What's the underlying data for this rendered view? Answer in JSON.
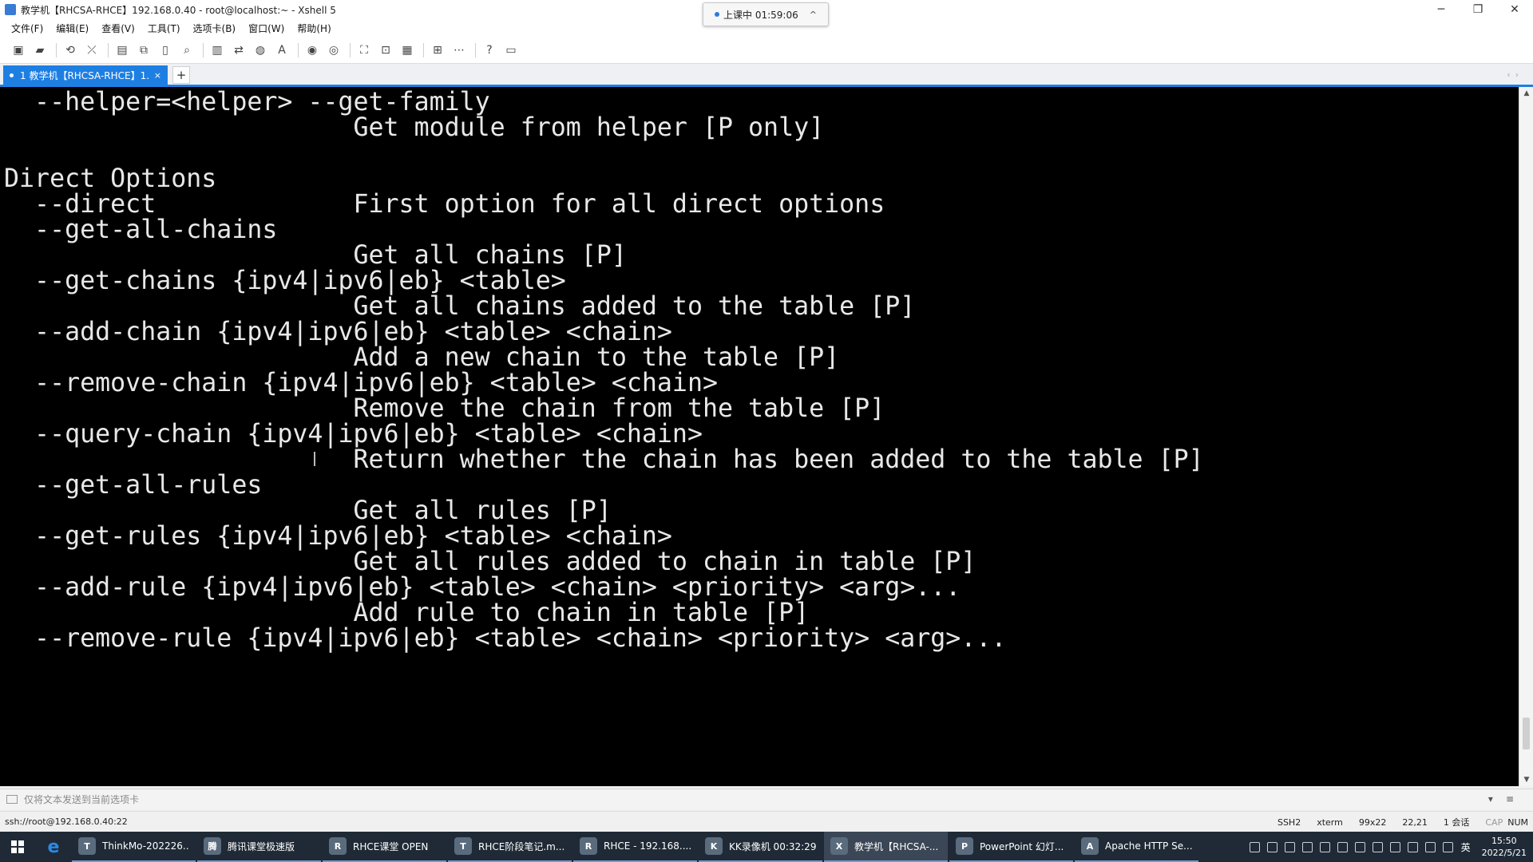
{
  "window": {
    "title": "教学机【RHCSA-RHCE】192.168.0.40 - root@localhost:~ - Xshell 5",
    "minimize": "─",
    "restore": "❐",
    "close": "✕"
  },
  "class_indicator": {
    "text": "上课中 01:59:06",
    "chevron": "^"
  },
  "menu": [
    "文件(F)",
    "编辑(E)",
    "查看(V)",
    "工具(T)",
    "选项卡(B)",
    "窗口(W)",
    "帮助(H)"
  ],
  "toolbar_icons": [
    "new-session-icon",
    "open-folder-icon",
    "reconnect-icon",
    "disconnect-icon",
    "properties-icon",
    "copy-icon",
    "paste-icon",
    "find-icon",
    "print-icon",
    "transfer-icon",
    "globe-icon",
    "font-icon",
    "xftp-icon",
    "xmanager-icon",
    "fullscreen-icon",
    "lock-icon",
    "keyboard-icon",
    "new-tab-icon",
    "layout-icon",
    "help-icon",
    "chat-icon"
  ],
  "tab": {
    "label": "1 教学机【RHCSA-RHCE】1...",
    "close": "×",
    "add": "+"
  },
  "terminal": {
    "lines": [
      "  --helper=<helper> --get-family",
      "                       Get module from helper [P only]",
      "",
      "Direct Options",
      "  --direct             First option for all direct options",
      "  --get-all-chains",
      "                       Get all chains [P]",
      "  --get-chains {ipv4|ipv6|eb} <table>",
      "                       Get all chains added to the table [P]",
      "  --add-chain {ipv4|ipv6|eb} <table> <chain>",
      "                       Add a new chain to the table [P]",
      "  --remove-chain {ipv4|ipv6|eb} <table> <chain>",
      "                       Remove the chain from the table [P]",
      "  --query-chain {ipv4|ipv6|eb} <table> <chain>",
      "                       Return whether the chain has been added to the table [P]",
      "  --get-all-rules",
      "                       Get all rules [P]",
      "  --get-rules {ipv4|ipv6|eb} <table> <chain>",
      "                       Get all rules added to chain in table [P]",
      "  --add-rule {ipv4|ipv6|eb} <table> <chain> <priority> <arg>...",
      "                       Add rule to chain in table [P]",
      "  --remove-rule {ipv4|ipv6|eb} <table> <chain> <priority> <arg>..."
    ]
  },
  "compose_bar": {
    "placeholder": "仅将文本发送到当前选项卡"
  },
  "statusbar": {
    "connection": "ssh://root@192.168.0.40:22",
    "protocol": "SSH2",
    "terminal_type": "xterm",
    "size": "99x22",
    "cursor_pos": "22,21",
    "sessions": "1 会话",
    "caps": "CAP",
    "num": "NUM"
  },
  "taskbar": {
    "tasks": [
      {
        "label": "ThinkMo-202226...",
        "icon": "T"
      },
      {
        "label": "腾讯课堂极速版",
        "icon": "腾"
      },
      {
        "label": "RHCE课堂 OPEN",
        "icon": "R"
      },
      {
        "label": "RHCE阶段笔记.m...",
        "icon": "T"
      },
      {
        "label": "RHCE - 192.168....",
        "icon": "R"
      },
      {
        "label": "KK录像机 00:32:29",
        "icon": "K"
      },
      {
        "label": "教学机【RHCSA-...",
        "icon": "X"
      },
      {
        "label": "PowerPoint 幻灯...",
        "icon": "P"
      },
      {
        "label": "Apache HTTP Se...",
        "icon": "A"
      }
    ],
    "lang": "英",
    "time": "15:50",
    "date": "2022/5/21"
  }
}
